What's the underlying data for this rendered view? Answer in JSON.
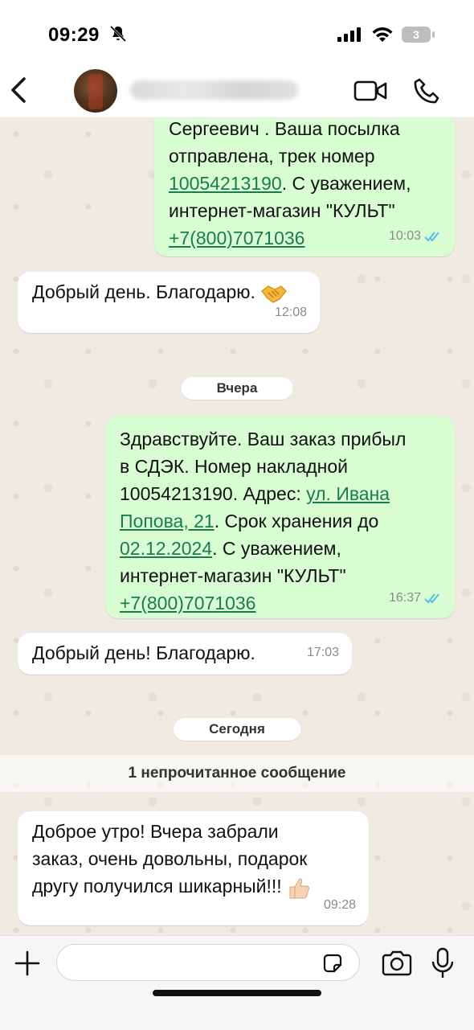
{
  "status_bar": {
    "time": "09:29",
    "battery_level": "3",
    "icons": [
      "bell-muted-icon",
      "signal-icon",
      "wifi-icon",
      "battery-icon"
    ]
  },
  "header": {
    "icons": [
      "back-icon",
      "video-call-icon",
      "voice-call-icon"
    ]
  },
  "messages": [
    {
      "direction": "outgoing",
      "lines": [
        "Сергеевич . Ваша посылка",
        "отправлена, трек номер"
      ],
      "track_link": "10054213190",
      "after_track": ". С уважением,",
      "line_shop": "интернет-магазин \"КУЛЬТ\"",
      "phone_link": "+7(800)7071036",
      "time": "10:03",
      "status": "read"
    },
    {
      "direction": "incoming",
      "text": "Добрый день. Благодарю.",
      "emoji": "handshake",
      "time": "12:08"
    },
    {
      "direction": "outgoing",
      "line1": "Здравствуйте. Ваш заказ прибыл",
      "line2": "в СДЭК. Номер накладной",
      "line3_pre": "10054213190. Адрес: ",
      "address_a": "ул. Ивана",
      "address_b": "Попова, 21",
      "line4_post": ". Срок хранения до",
      "date_link": "02.12.2024",
      "line5_post": ". С уважением,",
      "line_shop": "интернет-магазин \"КУЛЬТ\"",
      "phone_link": "+7(800)7071036",
      "time": "16:37",
      "status": "read"
    },
    {
      "direction": "incoming",
      "text": "Добрый день! Благодарю.",
      "time": "17:03"
    },
    {
      "direction": "incoming",
      "lines": [
        "Доброе утро! Вчера забрали",
        "заказ, очень довольны, подарок",
        "другу получился шикарный!!!"
      ],
      "emoji": "thumbs-up",
      "time": "09:28"
    }
  ],
  "date_separators": {
    "yesterday": "Вчера",
    "today": "Сегодня"
  },
  "unread_notice": "1 непрочитанное сообщение",
  "input": {
    "value": "",
    "icons": [
      "plus-icon",
      "sticker-icon",
      "camera-icon",
      "microphone-icon"
    ]
  },
  "colors": {
    "chat_bg": "#efeae2",
    "outgoing_bubble": "#d9fdd3",
    "incoming_bubble": "#ffffff",
    "link": "#1d7a4f",
    "read_ticks": "#53bdeb"
  }
}
